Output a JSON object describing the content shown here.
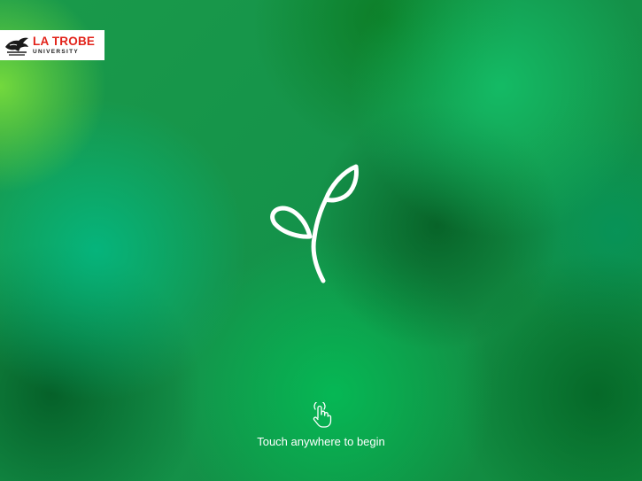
{
  "logo": {
    "name": "LA TROBE",
    "subtitle": "UNIVERSITY",
    "brand_color": "#e2231a"
  },
  "hero": {
    "icon": "sprout-icon"
  },
  "touch": {
    "icon": "touch-hand-icon",
    "prompt": "Touch anywhere to begin"
  },
  "colors": {
    "background": "#1a9a4a",
    "foreground": "#ffffff"
  }
}
